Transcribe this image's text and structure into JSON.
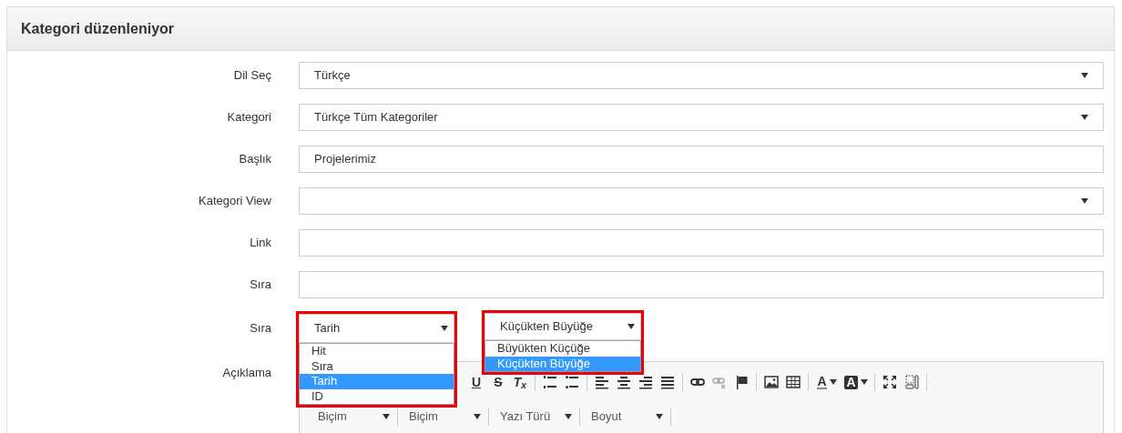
{
  "panel": {
    "title": "Kategori düzenleniyor"
  },
  "fields": [
    {
      "label": "Dil Seç",
      "kind": "select",
      "value": "Türkçe"
    },
    {
      "label": "Kategori",
      "kind": "select",
      "value": "Türkçe Tüm Kategoriler"
    },
    {
      "label": "Başlık",
      "kind": "text",
      "value": "Projelerimiz"
    },
    {
      "label": "Kategori View",
      "kind": "select"
    },
    {
      "label": "Link",
      "kind": "text"
    },
    {
      "label": "Sıra",
      "kind": "text"
    }
  ],
  "sort": {
    "label": "Sıra",
    "selects": [
      {
        "value": "Tarih",
        "expanded": true,
        "options": [
          {
            "label": "Hit",
            "selected": false
          },
          {
            "label": "Sıra",
            "selected": false
          },
          {
            "label": "Tarih",
            "selected": true
          },
          {
            "label": "ID",
            "selected": false
          }
        ]
      },
      {
        "value": "Küçükten Büyüğe",
        "expanded": true,
        "options": [
          {
            "label": "Büyükten Küçüğe",
            "selected": false
          },
          {
            "label": "Küçükten Büyüğe",
            "selected": true
          }
        ]
      }
    ]
  },
  "editor": {
    "label": "Açıklama",
    "toolbar": [
      [
        {
          "kind": "underline",
          "glyph": "U"
        },
        {
          "kind": "strike",
          "glyph": "S"
        },
        {
          "kind": "removeformat",
          "glyph": "T$_{x}$"
        }
      ],
      [
        {
          "kind": "numbered-list"
        },
        {
          "kind": "bullet-list"
        }
      ],
      [
        {
          "kind": "align-left"
        },
        {
          "kind": "align-center"
        },
        {
          "kind": "align-right"
        },
        {
          "kind": "justify"
        }
      ],
      [
        {
          "kind": "link"
        },
        {
          "kind": "unlink",
          "disabled": true
        },
        {
          "kind": "anchor"
        }
      ],
      [
        {
          "kind": "image"
        },
        {
          "kind": "table"
        }
      ],
      [
        {
          "kind": "text-color",
          "glyph": "A"
        },
        {
          "kind": "background-color",
          "glyph": "A"
        }
      ],
      [
        {
          "kind": "maximize"
        },
        {
          "kind": "show-blocks"
        }
      ]
    ],
    "combos": [
      {
        "label": "Biçim"
      },
      {
        "label": "Biçim"
      },
      {
        "label": "Yazı Türü"
      },
      {
        "label": "Boyut"
      }
    ]
  }
}
